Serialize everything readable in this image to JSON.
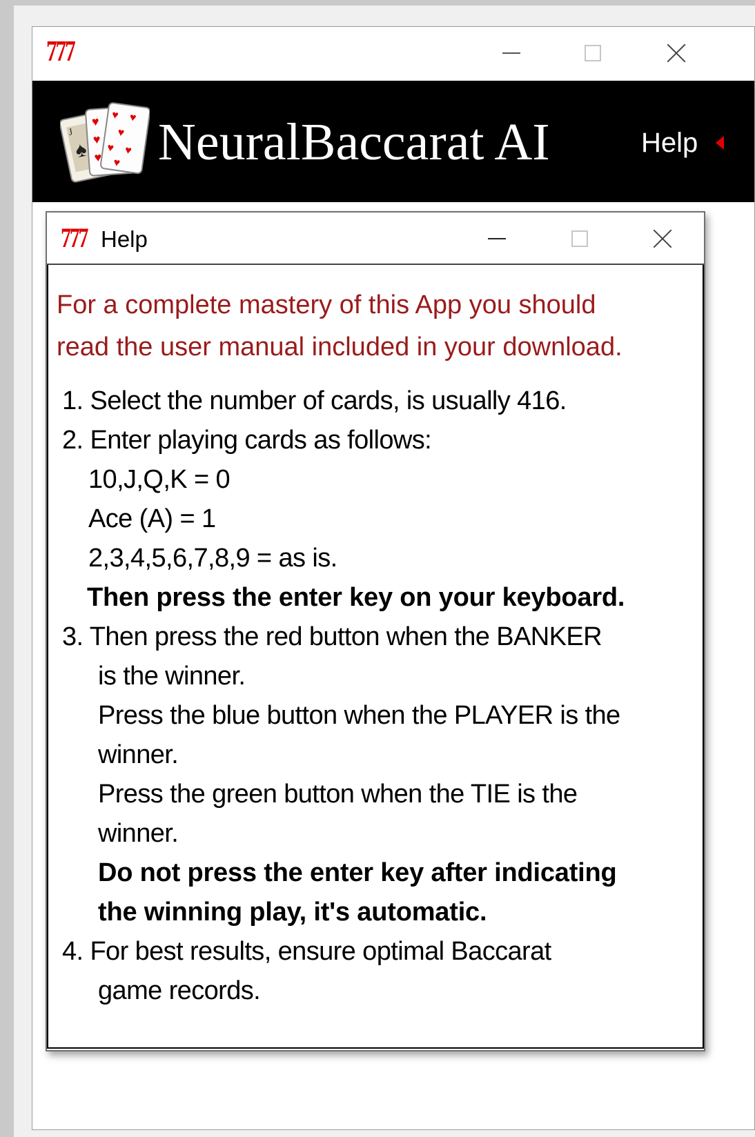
{
  "app": {
    "icon_text": "777",
    "title": "NeuralBaccarat AI",
    "menu_help": "Help"
  },
  "dialog": {
    "icon_text": "777",
    "title": "Help",
    "intro_line1": "For a complete mastery of this App you should",
    "intro_line2": "read the user manual included in your download.",
    "step1": "1. Select the number of cards, is usually 416.",
    "step2": "2. Enter playing cards as follows:",
    "step2_a": "10,J,Q,K = 0",
    "step2_b": "Ace (A) = 1",
    "step2_c": "2,3,4,5,6,7,8,9 = as is.",
    "step2_bold": "Then press the enter key on your keyboard.",
    "step3": "3. Then press the red button when the BANKER",
    "step3_cont": "is the winner.",
    "step3_blue1": "Press the blue button when the PLAYER is the",
    "step3_blue2": "winner.",
    "step3_green1": "Press the green button when the TIE is the",
    "step3_green2": "winner.",
    "step3_bold1": "Do not press the enter key after indicating",
    "step3_bold2": "the winning play, it's automatic.",
    "step4": "4. For best results, ensure optimal Baccarat",
    "step4_cont": "game records."
  },
  "colors": {
    "header_bg": "#000000",
    "intro_text": "#9b1b1b",
    "icon_red": "#e00000"
  },
  "icons": [
    "777-app-icon",
    "minimize-icon",
    "maximize-icon",
    "close-icon",
    "playing-cards-logo"
  ]
}
